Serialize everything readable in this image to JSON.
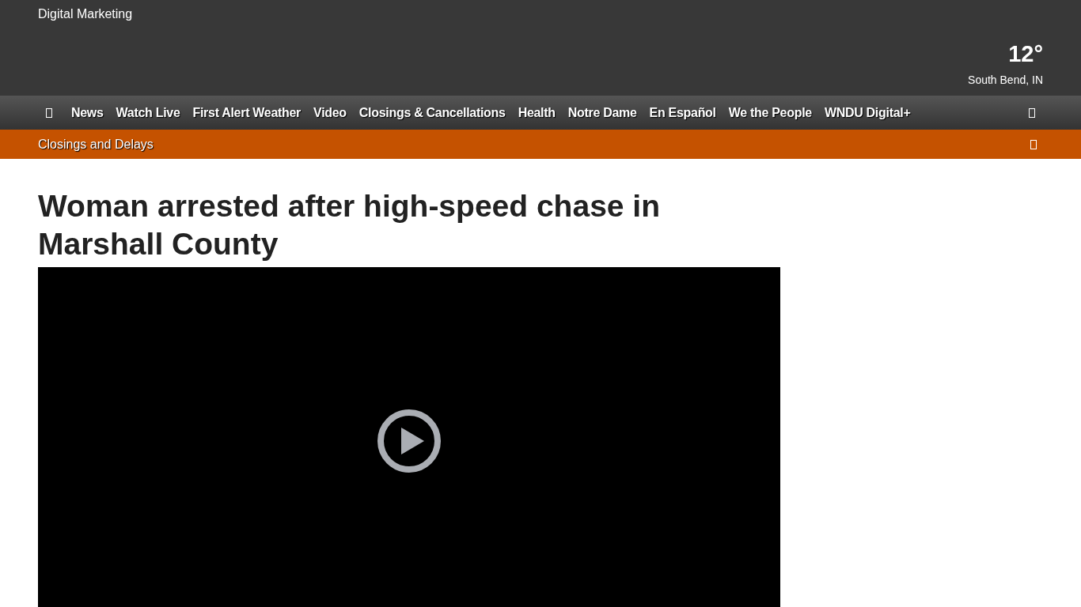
{
  "header": {
    "site_label": "Digital Marketing",
    "weather": {
      "temperature": "12°",
      "location": "South Bend, IN"
    }
  },
  "nav": {
    "items": [
      {
        "label": "News"
      },
      {
        "label": "Watch Live"
      },
      {
        "label": "First Alert Weather"
      },
      {
        "label": "Video"
      },
      {
        "label": "Closings & Cancellations"
      },
      {
        "label": "Health"
      },
      {
        "label": "Notre Dame"
      },
      {
        "label": "En Español"
      },
      {
        "label": "We the People"
      },
      {
        "label": "WNDU Digital+"
      }
    ]
  },
  "alert_bar": {
    "label": "Closings and Delays"
  },
  "article": {
    "headline": "Woman arrested after high-speed chase in Marshall County"
  }
}
